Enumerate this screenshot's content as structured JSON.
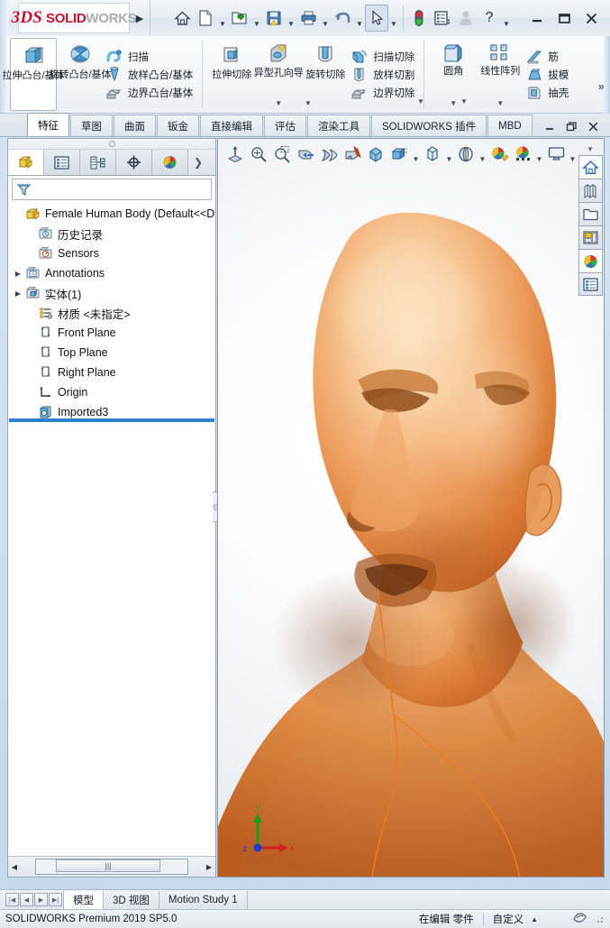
{
  "app": {
    "brand_ds": "3DS",
    "brand_solid": "SOLID",
    "brand_works": "WORKS",
    "accent_red": "#c8102e",
    "accent_gray": "#a8adb4",
    "selection_blue": "#2e7fd4"
  },
  "titlebar": {
    "expand_label": "▶",
    "buttons": [
      {
        "name": "home-icon",
        "glyph": "home",
        "caret": false,
        "selected": false
      },
      {
        "name": "new-document-icon",
        "glyph": "newdoc",
        "caret": true,
        "selected": false
      },
      {
        "name": "open-document-icon",
        "glyph": "open",
        "caret": true,
        "selected": false
      },
      {
        "name": "save-icon",
        "glyph": "save",
        "caret": true,
        "selected": false
      },
      {
        "name": "print-icon",
        "glyph": "print",
        "caret": true,
        "selected": false
      },
      {
        "name": "undo-icon",
        "glyph": "undo",
        "caret": true,
        "selected": false
      },
      {
        "name": "select-cursor-icon",
        "glyph": "cursor",
        "caret": true,
        "selected": true
      },
      {
        "name": "rebuild-icon",
        "glyph": "traffic",
        "caret": false,
        "selected": false
      },
      {
        "name": "options-icon",
        "glyph": "options",
        "caret": false,
        "selected": false
      },
      {
        "name": "user-account-icon",
        "glyph": "user",
        "caret": false,
        "selected": false
      },
      {
        "name": "help-icon",
        "glyph": "help",
        "caret": true,
        "selected": false
      }
    ],
    "window_controls": [
      {
        "name": "minimize-button",
        "glyph": "–"
      },
      {
        "name": "maximize-button",
        "glyph": "❐"
      },
      {
        "name": "close-button",
        "glyph": "✕"
      }
    ]
  },
  "ribbon": {
    "overflow_label": "»",
    "groups": [
      {
        "name": "boss-base-group",
        "big": [
          {
            "label": "拉伸凸台/基体",
            "icon": "extrude-boss-icon",
            "selected": true,
            "caret": false
          },
          {
            "label": "旋转凸台/基体",
            "icon": "revolve-boss-icon",
            "selected": false,
            "caret": false
          }
        ],
        "small": [
          {
            "label": "扫描",
            "icon": "sweep-icon"
          },
          {
            "label": "放样凸台/基体",
            "icon": "loft-boss-icon"
          },
          {
            "label": "边界凸台/基体",
            "icon": "boundary-boss-icon"
          }
        ]
      },
      {
        "name": "cut-group",
        "big": [
          {
            "label": "拉伸切除",
            "icon": "extrude-cut-icon",
            "selected": false,
            "caret": false
          },
          {
            "label": "异型孔向导",
            "icon": "hole-wizard-icon",
            "selected": false,
            "caret": true
          },
          {
            "label": "旋转切除",
            "icon": "revolve-cut-icon",
            "selected": false,
            "caret": false
          }
        ],
        "small": [
          {
            "label": "扫描切除",
            "icon": "sweep-cut-icon"
          },
          {
            "label": "放样切割",
            "icon": "loft-cut-icon"
          },
          {
            "label": "边界切除",
            "icon": "boundary-cut-icon"
          }
        ]
      },
      {
        "name": "feature-group",
        "big": [
          {
            "label": "圆角",
            "icon": "fillet-icon",
            "selected": false,
            "caret": true
          },
          {
            "label": "线性阵列",
            "icon": "linear-pattern-icon",
            "selected": false,
            "caret": true
          }
        ],
        "small": [
          {
            "label": "筋",
            "icon": "rib-icon"
          },
          {
            "label": "拔模",
            "icon": "draft-icon"
          },
          {
            "label": "抽壳",
            "icon": "shell-icon"
          }
        ]
      }
    ]
  },
  "command_tabs": {
    "items": [
      {
        "label": "特征",
        "active": true
      },
      {
        "label": "草图",
        "active": false
      },
      {
        "label": "曲面",
        "active": false
      },
      {
        "label": "钣金",
        "active": false
      },
      {
        "label": "直接编辑",
        "active": false
      },
      {
        "label": "评估",
        "active": false
      },
      {
        "label": "渲染工具",
        "active": false
      },
      {
        "label": "SOLIDWORKS 插件",
        "active": false
      },
      {
        "label": "MBD",
        "active": false
      }
    ],
    "window_controls": [
      {
        "name": "doc-minimize-button",
        "glyph": "–"
      },
      {
        "name": "doc-restore-button",
        "glyph": "❐"
      },
      {
        "name": "doc-close-button",
        "glyph": "✕"
      }
    ]
  },
  "feature_manager": {
    "tabs": [
      {
        "name": "feature-tree-tab",
        "icon": "feature-tree-icon",
        "active": true
      },
      {
        "name": "property-manager-tab",
        "icon": "property-manager-icon",
        "active": false
      },
      {
        "name": "configuration-manager-tab",
        "icon": "configuration-icon",
        "active": false
      },
      {
        "name": "dimxpert-manager-tab",
        "icon": "dimxpert-icon",
        "active": false
      },
      {
        "name": "display-manager-tab",
        "icon": "display-manager-icon",
        "active": false
      },
      {
        "name": "more-tabs-button",
        "icon": "chevron-right-icon",
        "active": false
      }
    ],
    "filter_placeholder": "",
    "root": {
      "label": "Female Human Body  (Default<<D",
      "icon": "part-icon"
    },
    "nodes": [
      {
        "label": "历史记录",
        "icon": "history-icon",
        "expandable": false
      },
      {
        "label": "Sensors",
        "icon": "sensors-icon",
        "expandable": false
      },
      {
        "label": "Annotations",
        "icon": "annotations-icon",
        "expandable": true
      },
      {
        "label": "实体(1)",
        "icon": "solid-bodies-icon",
        "expandable": true
      },
      {
        "label": "材质 <未指定>",
        "icon": "material-icon",
        "expandable": false
      },
      {
        "label": "Front Plane",
        "icon": "plane-icon",
        "expandable": false
      },
      {
        "label": "Top Plane",
        "icon": "plane-icon",
        "expandable": false
      },
      {
        "label": "Right Plane",
        "icon": "plane-icon",
        "expandable": false
      },
      {
        "label": "Origin",
        "icon": "origin-icon",
        "expandable": false
      },
      {
        "label": "Imported3",
        "icon": "imported-feature-icon",
        "expandable": false
      }
    ],
    "hscroll": {
      "left_arrow": "◀",
      "right_arrow": "▶",
      "thumb_grip": "|||"
    }
  },
  "graphics": {
    "view_toolbar": [
      {
        "name": "zoom-to-fit-icon",
        "glyph": "zoomfit",
        "caret": false
      },
      {
        "name": "zoom-to-area-icon",
        "glyph": "zoomarea",
        "caret": false
      },
      {
        "name": "previous-view-icon",
        "glyph": "zoomprev",
        "caret": false
      },
      {
        "name": "section-view-icon",
        "glyph": "section",
        "caret": false
      },
      {
        "name": "view-orientation-icon",
        "glyph": "orient",
        "caret": false
      },
      {
        "name": "view-selector-icon",
        "glyph": "viewsel",
        "caret": false
      },
      {
        "name": "display-style-icon",
        "glyph": "dispstyle",
        "caret": false
      },
      {
        "name": "hide-show-items-icon",
        "glyph": "hideshow",
        "caret": true
      },
      {
        "name": "edit-appearance-icon",
        "glyph": "appearance",
        "caret": true
      },
      {
        "name": "apply-scene-icon",
        "glyph": "scene",
        "caret": true
      },
      {
        "name": "view-settings-icon",
        "glyph": "viewset",
        "caret": true
      },
      {
        "name": "appearances-icon",
        "glyph": "appear2",
        "caret": false
      },
      {
        "name": "scenes-icon",
        "glyph": "scene2",
        "caret": true
      },
      {
        "name": "viewport-icon",
        "glyph": "viewport",
        "caret": true
      }
    ],
    "triad": {
      "x_label": "x",
      "y_label": "y",
      "z_label": "z",
      "x_color": "#d42020",
      "y_color": "#18a018",
      "z_color": "#1a3ed0"
    },
    "model_name": "female-human-body-model",
    "model_color": "#e0873f"
  },
  "task_pane": {
    "items": [
      {
        "name": "solidworks-resources-button",
        "icon": "home-icon"
      },
      {
        "name": "design-library-button",
        "icon": "library-icon"
      },
      {
        "name": "file-explorer-button",
        "icon": "folder-icon"
      },
      {
        "name": "view-palette-button",
        "icon": "view-palette-icon"
      },
      {
        "name": "appearances-scenes-button",
        "icon": "appearances-sphere-icon"
      },
      {
        "name": "custom-properties-button",
        "icon": "custom-properties-icon"
      }
    ]
  },
  "bottom_tabs": {
    "nav": [
      {
        "name": "first-tab-button",
        "glyph": "⏮"
      },
      {
        "name": "prev-tab-button",
        "glyph": "◀"
      },
      {
        "name": "next-tab-button",
        "glyph": "▶"
      },
      {
        "name": "last-tab-button",
        "glyph": "⏭"
      }
    ],
    "tabs": [
      {
        "label": "模型",
        "active": true
      },
      {
        "label": "3D 视图",
        "active": false
      },
      {
        "label": "Motion Study 1",
        "active": false
      }
    ]
  },
  "status_bar": {
    "version": "SOLIDWORKS Premium 2019 SP5.0",
    "edit_state": "在编辑 零件",
    "custom": "自定义",
    "custom_caret": "▲",
    "overlay_icon": "overlay-icon"
  }
}
